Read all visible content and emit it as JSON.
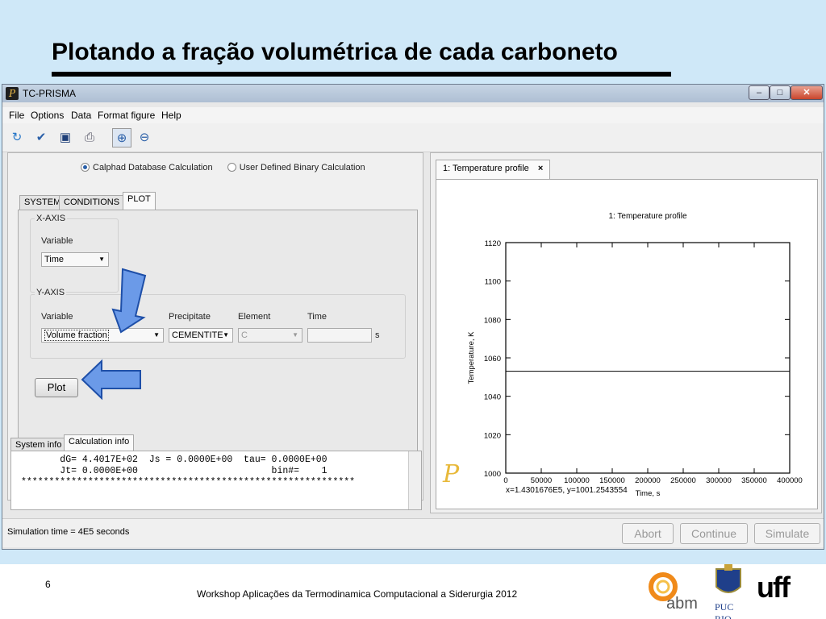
{
  "slide": {
    "title": "Plotando a fração volumétrica de cada carboneto",
    "page_number": "6",
    "footer": "Workshop Aplicações da Termodinamica Computacional a Siderurgia 2012",
    "logos": [
      "abm",
      "PUC RIO",
      "uff"
    ]
  },
  "window": {
    "title": "TC-PRISMA",
    "menu": [
      "File",
      "Options",
      "Data",
      "Format figure",
      "Help"
    ],
    "toolbar_icons": [
      "refresh-icon",
      "check-icon",
      "save-icon",
      "print-icon",
      "zoom-in-icon",
      "zoom-out-icon"
    ]
  },
  "calc_mode": {
    "options": [
      "Calphad Database Calculation",
      "User Defined Binary Calculation"
    ],
    "selected": "Calphad Database Calculation"
  },
  "tabs": [
    "SYSTEM",
    "CONDITIONS",
    "PLOT"
  ],
  "active_tab": "PLOT",
  "plot_form": {
    "x_axis": {
      "label": "X-AXIS",
      "variable_label": "Variable",
      "variable": "Time"
    },
    "y_axis": {
      "label": "Y-AXIS",
      "variable_label": "Variable",
      "variable": "Volume fraction",
      "precipitate_label": "Precipitate",
      "precipitate": "CEMENTITE",
      "element_label": "Element",
      "element": "C",
      "time_label": "Time",
      "time_value": "",
      "time_unit": "s"
    },
    "plot_button": "Plot"
  },
  "console": {
    "tabs": [
      "System info",
      "Calculation info"
    ],
    "active_tab": "Calculation info",
    "lines": [
      "       dG= 4.4017E+02  Js = 0.0000E+00  tau= 0.0000E+00",
      "       Jt= 0.0000E+00                        bin#=    1",
      "************************************************************"
    ]
  },
  "status": {
    "text": "Simulation time = 4E5 seconds",
    "buttons": [
      "Abort",
      "Continue",
      "Simulate"
    ]
  },
  "plot_panel": {
    "tab_label": "1: Temperature profile",
    "tab_close": "×",
    "coords_readout": "x=1.4301676E5, y=1001.2543554"
  },
  "chart_data": {
    "type": "line",
    "title": "1: Temperature profile",
    "xlabel": "Time, s",
    "ylabel": "Temperature, K",
    "xlim": [
      0,
      400000
    ],
    "ylim": [
      1000,
      1120
    ],
    "xticks": [
      0,
      50000,
      100000,
      150000,
      200000,
      250000,
      300000,
      350000,
      400000
    ],
    "yticks": [
      1000,
      1020,
      1040,
      1060,
      1080,
      1100,
      1120
    ],
    "series": [
      {
        "x": [
          0,
          400000
        ],
        "y": [
          1053,
          1053
        ],
        "color": "#000000"
      }
    ]
  }
}
